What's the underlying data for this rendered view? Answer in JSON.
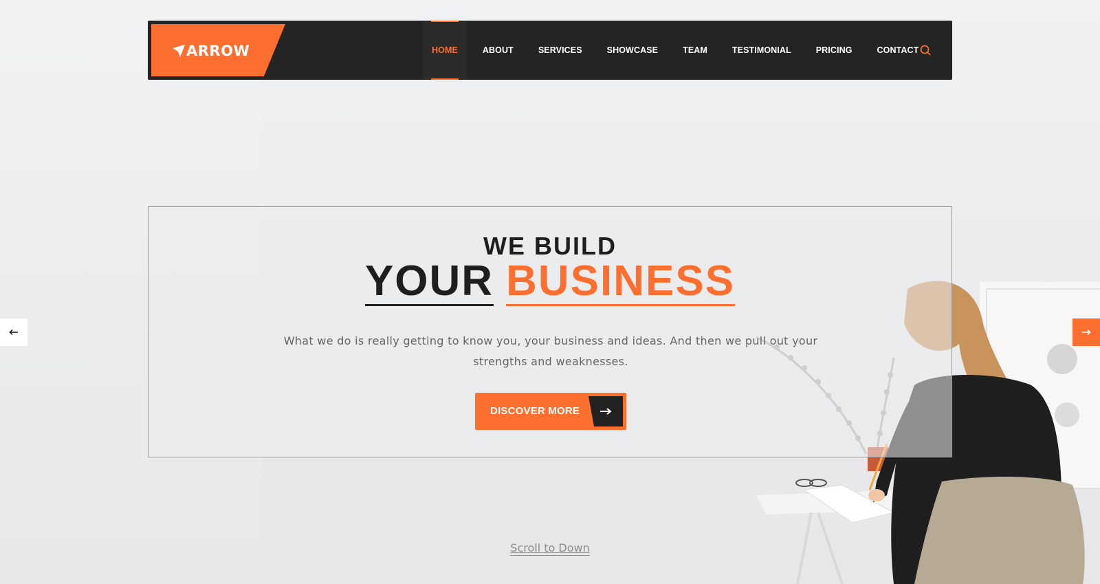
{
  "brand": {
    "name": "ARROW",
    "accent": "#fd6f2f",
    "dark": "#242424"
  },
  "nav": {
    "items": [
      {
        "label": "HOME",
        "active": true
      },
      {
        "label": "ABOUT",
        "active": false
      },
      {
        "label": "SERVICES",
        "active": false
      },
      {
        "label": "SHOWCASE",
        "active": false
      },
      {
        "label": "TEAM",
        "active": false
      },
      {
        "label": "TESTIMONIAL",
        "active": false
      },
      {
        "label": "PRICING",
        "active": false
      },
      {
        "label": "CONTACT",
        "active": false
      }
    ],
    "search_icon": "search-icon"
  },
  "hero": {
    "heading_small": "WE BUILD",
    "heading_word1": "YOUR",
    "heading_word2": "BUSINESS",
    "description": "What we do is really getting to know you, your business and ideas. And then we pull out your strengths and weaknesses.",
    "cta_label": "DISCOVER MORE",
    "cta_icon": "arrow-right-icon"
  },
  "slider": {
    "prev_icon": "arrow-left-icon",
    "next_icon": "arrow-right-icon"
  },
  "scroll_label": "Scroll to Down"
}
